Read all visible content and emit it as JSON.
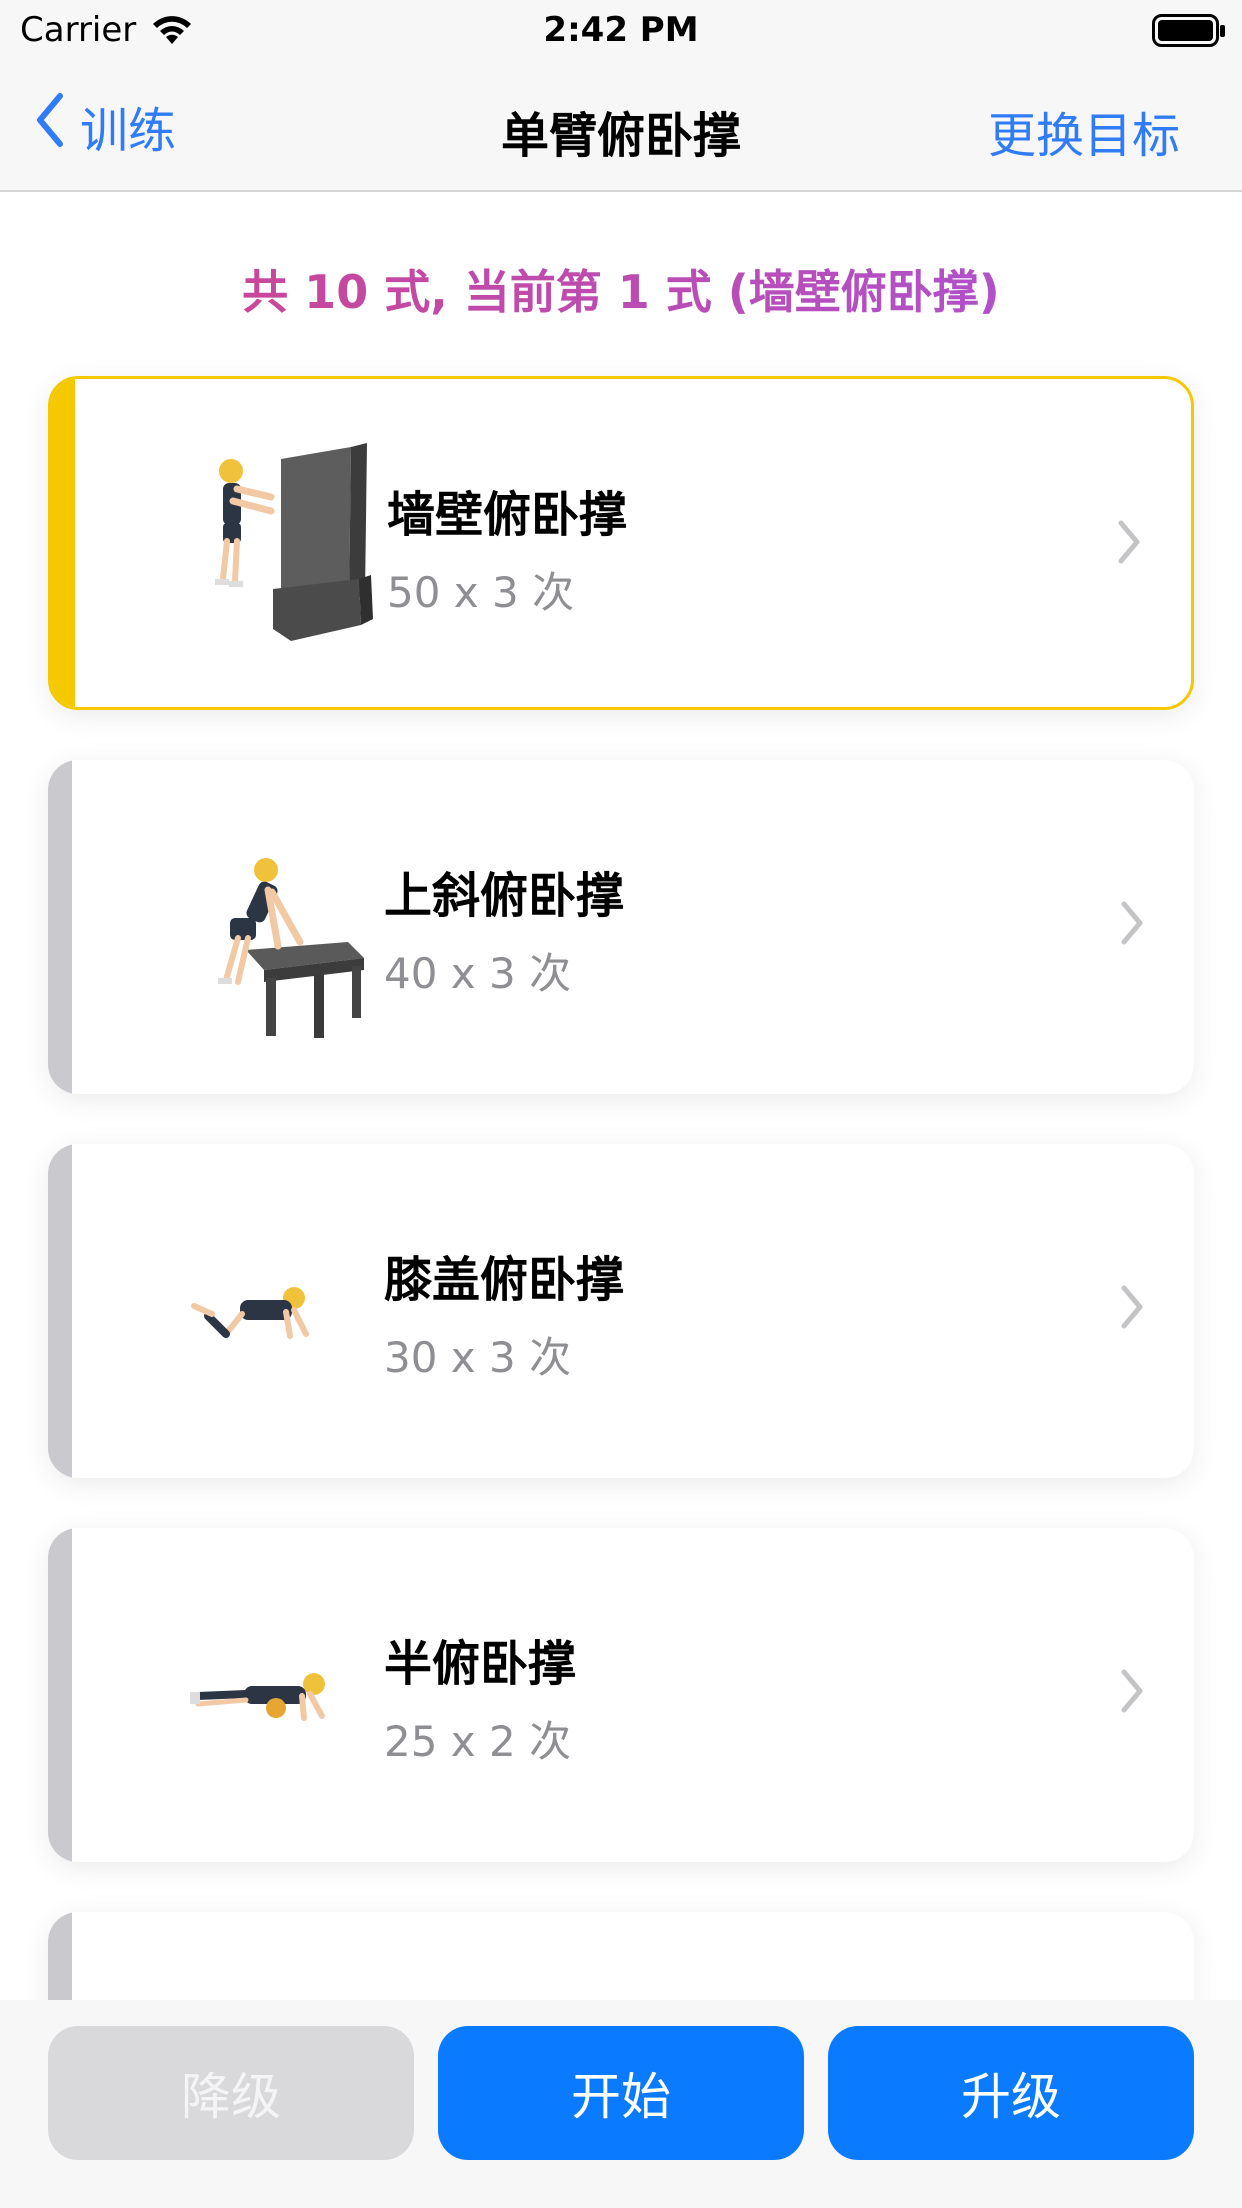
{
  "status": {
    "carrier": "Carrier",
    "time": "2:42 PM"
  },
  "nav": {
    "back_label": "训练",
    "title": "单臂俯卧撑",
    "right_label": "更换目标"
  },
  "subtitle": "共 10 式, 当前第 1 式 (墙壁俯卧撑)",
  "items": [
    {
      "name": "墙壁俯卧撑",
      "reps": "50 x 3 次",
      "active": true
    },
    {
      "name": "上斜俯卧撑",
      "reps": "40 x 3 次",
      "active": false
    },
    {
      "name": "膝盖俯卧撑",
      "reps": "30 x 3 次",
      "active": false
    },
    {
      "name": "半俯卧撑",
      "reps": "25 x 2 次",
      "active": false
    }
  ],
  "buttons": {
    "downgrade": "降级",
    "start": "开始",
    "upgrade": "升级"
  },
  "colors": {
    "accent": "#0a7bff",
    "nav_link": "#2f7cf6",
    "active_bar": "#f6c800",
    "inactive_bar": "#c9c9ce",
    "disabled_button": "#d9d9db"
  }
}
